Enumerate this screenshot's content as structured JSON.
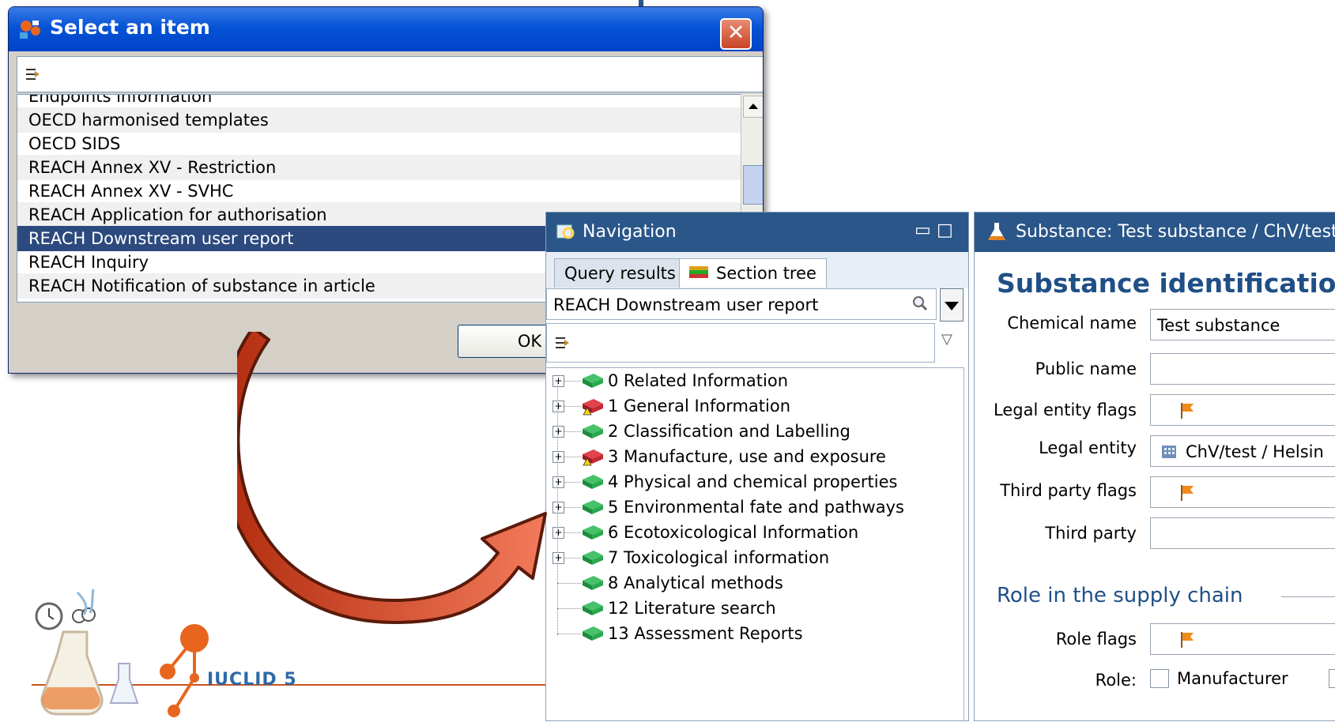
{
  "select_dialog": {
    "title": "Select an item",
    "close": "✕",
    "items": [
      "Endpoints information",
      "OECD harmonised templates",
      "OECD SIDS",
      "REACH Annex XV - Restriction",
      "REACH Annex XV - SVHC",
      "REACH Application for authorisation",
      "REACH Downstream user report",
      "REACH Inquiry",
      "REACH Notification of substance in article"
    ],
    "selected_item": "REACH Downstream user report",
    "ok_label": "OK"
  },
  "navigation": {
    "title": "Navigation",
    "tabs": [
      "Query results",
      "Section tree"
    ],
    "active_tab": "Section tree",
    "search_value": "REACH Downstream user report",
    "tree": [
      {
        "label": "0 Related Information",
        "expandable": true,
        "status": "green"
      },
      {
        "label": "1 General Information",
        "expandable": true,
        "status": "red"
      },
      {
        "label": "2 Classification and Labelling",
        "expandable": true,
        "status": "green"
      },
      {
        "label": "3 Manufacture, use and exposure",
        "expandable": true,
        "status": "red"
      },
      {
        "label": "4 Physical and chemical properties",
        "expandable": true,
        "status": "green"
      },
      {
        "label": "5 Environmental fate and pathways",
        "expandable": true,
        "status": "green"
      },
      {
        "label": "6 Ecotoxicological Information",
        "expandable": true,
        "status": "green"
      },
      {
        "label": "7 Toxicological information",
        "expandable": true,
        "status": "green"
      },
      {
        "label": "8 Analytical methods",
        "expandable": false,
        "status": "green"
      },
      {
        "label": "12 Literature search",
        "expandable": false,
        "status": "green"
      },
      {
        "label": "13 Assessment Reports",
        "expandable": false,
        "status": "green"
      }
    ]
  },
  "substance": {
    "title": "Substance: Test substance / ChV/test",
    "heading": "Substance identificatio",
    "fields": {
      "chemical_name_label": "Chemical name",
      "chemical_name_value": "Test substance",
      "public_name_label": "Public name",
      "legal_entity_flags_label": "Legal entity flags",
      "legal_entity_label": "Legal entity",
      "legal_entity_value": "ChV/test / Helsin",
      "third_party_flags_label": "Third party flags",
      "third_party_label": "Third party"
    },
    "role_section": "Role in the supply chain",
    "role_flags_label": "Role flags",
    "role_label": "Role:",
    "role_option": "Manufacturer"
  },
  "logo": {
    "text": "IUCLID 5"
  },
  "colors": {
    "panel_header": "#2a5689",
    "selection": "#2c4a7d",
    "arrow": "#e23a1a",
    "heading": "#1f4f86"
  }
}
